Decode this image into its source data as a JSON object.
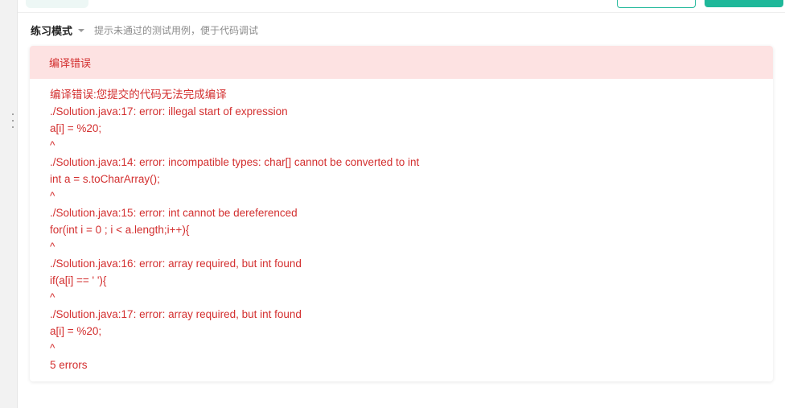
{
  "mode": {
    "label": "练习模式",
    "hint": "提示未通过的测试用例，便于代码调试"
  },
  "result": {
    "title": "编译错误",
    "lines": [
      "编译错误:您提交的代码无法完成编译",
      "./Solution.java:17: error: illegal start of expression",
      "a[i] = %20;",
      "^",
      "./Solution.java:14: error: incompatible types: char[] cannot be converted to int",
      "int a = s.toCharArray();",
      "^",
      "./Solution.java:15: error: int cannot be dereferenced",
      "for(int i = 0 ; i < a.length;i++){",
      "^",
      "./Solution.java:16: error: array required, but int found",
      "if(a[i] == ' '){",
      "^",
      "./Solution.java:17: error: array required, but int found",
      "a[i] = %20;",
      "^",
      "5 errors"
    ]
  },
  "colors": {
    "error_text": "#d32f2f",
    "error_bg": "#fde2e2",
    "accent": "#1fb89a"
  }
}
